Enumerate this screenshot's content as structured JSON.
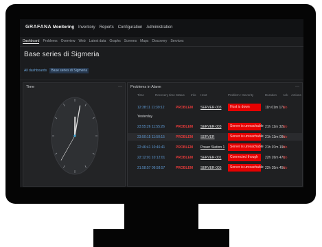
{
  "app": {
    "logo_text": "GRAFANA"
  },
  "main_menu": [
    "Monitoring",
    "Inventory",
    "Reports",
    "Configuration",
    "Administration"
  ],
  "main_menu_active": 0,
  "sub_menu": [
    "Dashboard",
    "Problems",
    "Overview",
    "Web",
    "Latest data",
    "Graphs",
    "Screens",
    "Maps",
    "Discovery",
    "Services"
  ],
  "sub_menu_active": 0,
  "page": {
    "title": "Base series di Sigmeria"
  },
  "filter": {
    "all_label": "All dashboards",
    "selected": "Base series di Sigmeria"
  },
  "clock_widget": {
    "title": "Time",
    "hour": 12,
    "minute": 2,
    "second": 37
  },
  "problems_widget": {
    "title": "Problems in Alarm",
    "columns": [
      "Time",
      "Recovery time",
      "Status",
      "Info",
      "Host",
      "Problem • Severity",
      "Duration",
      "Ack",
      "Actions"
    ],
    "today_rows": [
      {
        "time": "12:38:11 11:39:12",
        "status": "PROBLEM",
        "host": "SERVER-003",
        "problem": "Host is down",
        "duration": "11h 01m 17s",
        "ack": "No"
      }
    ],
    "yesterday_label": "Yesterday",
    "yesterday_rows": [
      {
        "time": "23:55:26 11:55:26",
        "status": "PROBLEM",
        "host": "SERVER-003",
        "problem": "Server is unreachable",
        "duration": "21h 11m 32s",
        "ack": "No"
      },
      {
        "time": "23:50:15 11:50:15",
        "status": "PROBLEM",
        "host": "SERVER",
        "problem": "Server is unreachable",
        "duration": "21h 13m 09s",
        "ack": "No"
      },
      {
        "time": "22:46:41 10:46:41",
        "status": "PROBLEM",
        "host": "Power Station 1",
        "problem": "Server is unreachable",
        "duration": "21h 07m 19s",
        "ack": "No"
      },
      {
        "time": "22:12:01 10:12:01",
        "status": "PROBLEM",
        "host": "SERVER-001",
        "problem": "Connected though",
        "duration": "22h 26m 47s",
        "ack": "No"
      },
      {
        "time": "21:58:57 09:58:57",
        "status": "PROBLEM",
        "host": "SERVER-005",
        "problem": "Server is unreachable",
        "duration": "22h 35m 45s",
        "ack": "No"
      }
    ]
  },
  "colors": {
    "problem_bg": "#e60000",
    "link": "#5f9bd6",
    "status": "#e03a3a",
    "monitor": "#050505"
  }
}
